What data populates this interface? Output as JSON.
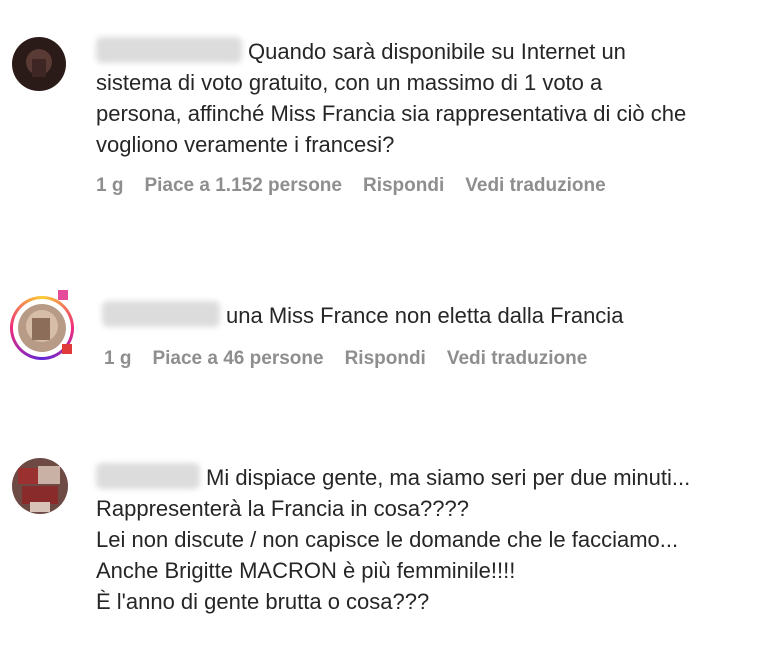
{
  "comments": [
    {
      "text": "Quando sarà disponibile su Internet un\nsistema di voto gratuito, con un massimo di 1 voto a\npersona, affinché Miss Francia sia rappresentativa di ciò che\nvogliono veramente i francesi?",
      "time": "1 g",
      "likes": "Piace a 1.152 persone",
      "reply": "Rispondi",
      "translate": "Vedi traduzione"
    },
    {
      "text": "una Miss France non eletta dalla Francia",
      "time": "1 g",
      "likes": "Piace a 46 persone",
      "reply": "Rispondi",
      "translate": "Vedi traduzione"
    },
    {
      "text": "Mi dispiace gente, ma siamo seri per due minuti...\nRappresenterà la Francia in cosa????\nLei non discute / non capisce le domande che le facciamo...\nAnche Brigitte MACRON è più femminile!!!!\nÈ l'anno di gente brutta o cosa???"
    }
  ],
  "colors": {
    "text": "#262626",
    "meta": "#8e8e8e",
    "story_ring": "#e1306c"
  }
}
